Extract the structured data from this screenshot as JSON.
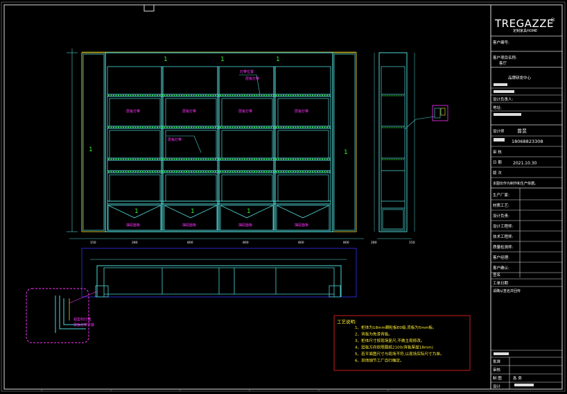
{
  "brand": {
    "logo_text": "TREGAZZE",
    "logo_mark": "®",
    "logo_sub": "定制家具HOME"
  },
  "title_block": {
    "customer_no_label": "客户编号:",
    "project_label": "客户项目名称:",
    "project_value": "客厅",
    "design_center": "品牌研发中心",
    "designer_label": "设计负责人:",
    "address_label": "地址:",
    "drawer_label": "设计师",
    "drawer_name": "曾昱",
    "phone": "18068823308",
    "check_label": "审 核",
    "date_label": "日 期",
    "date_value": "2021.10.30",
    "version_label": "版 次",
    "note_label": "本图仅作为制作和生产依据。",
    "rows": [
      "生产厂家:",
      "材质工艺:",
      "设计负责:",
      "设计工程师:",
      "技术工程师:",
      "质量检测师:",
      "客户经理:",
      "客户确认:"
    ],
    "sign_label": "签名",
    "work_label": "工单日期",
    "confirm_label": "请确认签名并回传",
    "bottom_rows": [
      "批准",
      "审核",
      "设计"
    ],
    "bottom_value": "各 类",
    "bottom_cell": "制 图"
  },
  "elevation": {
    "section_marks": [
      "1",
      "1",
      "1",
      "1",
      "1",
      "1",
      "1",
      "1"
    ],
    "shelf_labels": [
      "层板灯带",
      "层板灯带",
      "层板灯带",
      "层板灯带"
    ],
    "drawer_labels": [
      "抽屉面板",
      "抽屉面板",
      "抽屉面板",
      "抽屉面板"
    ],
    "annotations": [
      "灯带位置",
      "层板灯带",
      "层板灯带"
    ],
    "dims_bottom": [
      "150",
      "280",
      "800",
      "800",
      "800",
      "800",
      "280",
      "150"
    ]
  },
  "detail_note": {
    "line1": "铝型材灯槽,",
    "line2": "层板灯带安装"
  },
  "notes": {
    "title": "工艺说明:",
    "items": [
      "1、柜体为18mm颗粒板E0级,背板为5mm板。",
      "2、背板为免漆背板。",
      "3、柜体尺寸按现场复尺,不做主观修改。",
      "4、层板方向依照图纸2100(背板厚度18mm)",
      "5、若平面图尺寸与现场不符,以现场实际尺寸为准。",
      "6、其他细节工厂自行确定。"
    ]
  },
  "colors": {
    "cyan": "#4fd8d8",
    "green": "#33ee33",
    "yellow": "#ffee33",
    "magenta": "#ff33ff",
    "blue": "#3333ff",
    "red": "#ff2222",
    "white": "#ffffff"
  }
}
